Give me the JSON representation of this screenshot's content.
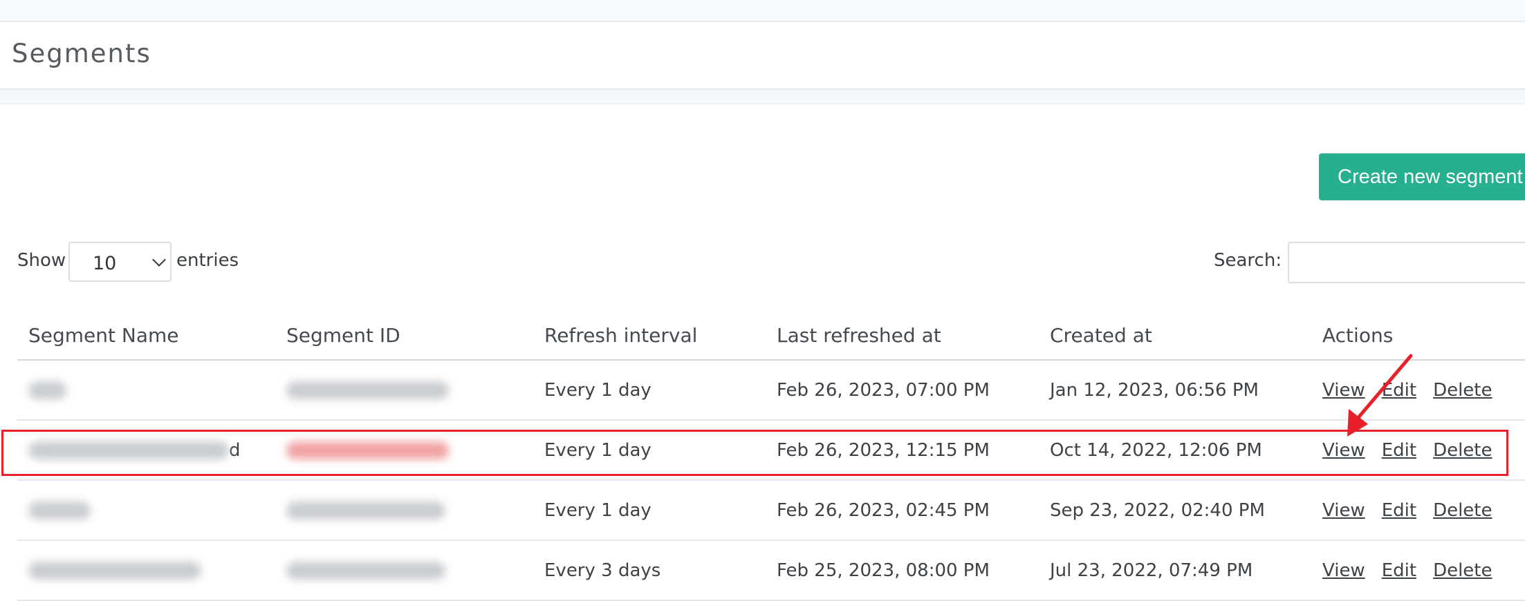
{
  "page": {
    "title": "Segments",
    "create_button_label": "Create new segment"
  },
  "controls": {
    "show_label": "Show",
    "page_size": "10",
    "entries_label": "entries",
    "search_label": "Search:",
    "search_value": ""
  },
  "table": {
    "columns": [
      "Segment Name",
      "Segment ID",
      "Refresh interval",
      "Last refreshed at",
      "Created at",
      "Actions"
    ],
    "rows": [
      {
        "refresh": "Every 1 day",
        "last_refreshed": "Feb 26, 2023, 07:00 PM",
        "created": "Jan 12, 2023, 06:56 PM"
      },
      {
        "refresh": "Every 1 day",
        "last_refreshed": "Feb 26, 2023, 12:15 PM",
        "created": "Oct 14, 2022, 12:06 PM",
        "name_tail": "d"
      },
      {
        "refresh": "Every 1 day",
        "last_refreshed": "Feb 26, 2023, 02:45 PM",
        "created": "Sep 23, 2022, 02:40 PM"
      },
      {
        "refresh": "Every 3 days",
        "last_refreshed": "Feb 25, 2023, 08:00 PM",
        "created": "Jul 23, 2022, 07:49 PM"
      }
    ],
    "actions": {
      "view": "View",
      "edit": "Edit",
      "delete": "Delete"
    }
  },
  "annotation": {
    "highlight_color": "#e8202a",
    "highlighted_row": 2
  }
}
